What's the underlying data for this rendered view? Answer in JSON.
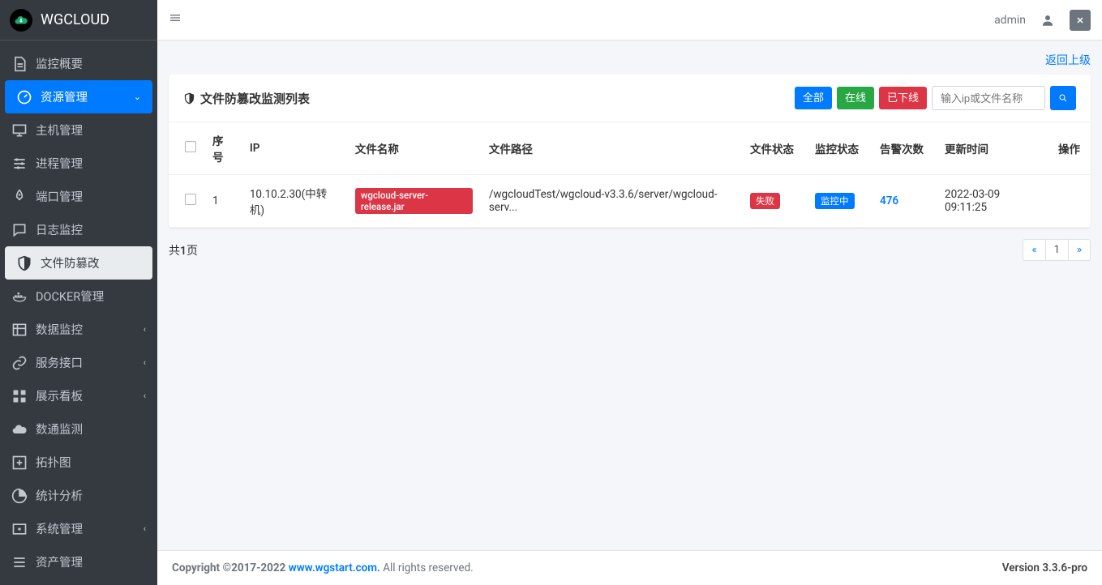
{
  "brand": "WGCLOUD",
  "topbar": {
    "username": "admin"
  },
  "sidebar": {
    "items": [
      {
        "label": "监控概要",
        "icon": "file"
      },
      {
        "label": "资源管理",
        "icon": "dashboard",
        "active": true,
        "caret": "down"
      },
      {
        "label": "主机管理",
        "icon": "desktop",
        "sub": true
      },
      {
        "label": "进程管理",
        "icon": "sliders",
        "sub": true
      },
      {
        "label": "端口管理",
        "icon": "rocket",
        "sub": true
      },
      {
        "label": "日志监控",
        "icon": "comment",
        "sub": true
      },
      {
        "label": "文件防篡改",
        "icon": "shield",
        "sub": true,
        "subActive": true
      },
      {
        "label": "DOCKER管理",
        "icon": "docker",
        "sub": true
      },
      {
        "label": "数据监控",
        "icon": "table",
        "caret": "left"
      },
      {
        "label": "服务接口",
        "icon": "link",
        "caret": "left"
      },
      {
        "label": "展示看板",
        "icon": "grid",
        "caret": "left"
      },
      {
        "label": "数通监测",
        "icon": "cloud"
      },
      {
        "label": "拓扑图",
        "icon": "plus-square"
      },
      {
        "label": "统计分析",
        "icon": "pie"
      },
      {
        "label": "系统管理",
        "icon": "cog",
        "caret": "left"
      },
      {
        "label": "资产管理",
        "icon": "list"
      }
    ]
  },
  "page": {
    "back_link": "返回上级",
    "title": "文件防篡改监测列表",
    "filters": {
      "all": "全部",
      "online": "在线",
      "offline": "已下线"
    },
    "search_placeholder": "输入ip或文件名称",
    "columns": [
      "序号",
      "IP",
      "文件名称",
      "文件路径",
      "文件状态",
      "监控状态",
      "告警次数",
      "更新时间",
      "操作"
    ],
    "rows": [
      {
        "seq": "1",
        "ip": "10.10.2.30(中转机)",
        "filename": "wgcloud-server-release.jar",
        "filepath": "/wgcloudTest/wgcloud-v3.3.6/server/wgcloud-serv...",
        "file_status": "失败",
        "monitor_status": "监控中",
        "alarm_count": "476",
        "updated": "2022-03-09 09:11:25"
      }
    ],
    "page_info": "共1页",
    "pagination": {
      "prev": "«",
      "current": "1",
      "next": "»"
    }
  },
  "footer": {
    "copyright_prefix": "Copyright ©2017-2022 ",
    "site": "www.wgstart.com.",
    "copyright_suffix": " All rights reserved.",
    "version_label": "Version 3.3.6-pro"
  }
}
